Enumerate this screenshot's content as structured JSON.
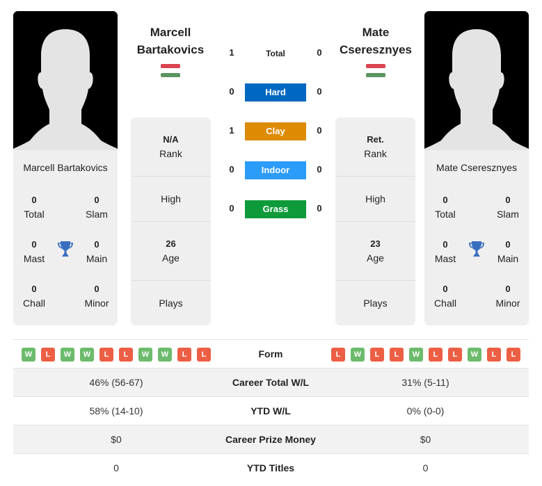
{
  "player1": {
    "name_line1": "Marcell",
    "name_line2": "Bartakovics",
    "full_name": "Marcell Bartakovics",
    "flag": "hungary-flag",
    "titles": {
      "total": {
        "value": "0",
        "label": "Total"
      },
      "slam": {
        "value": "0",
        "label": "Slam"
      },
      "mast": {
        "value": "0",
        "label": "Mast"
      },
      "main": {
        "value": "0",
        "label": "Main"
      },
      "chall": {
        "value": "0",
        "label": "Chall"
      },
      "minor": {
        "value": "0",
        "label": "Minor"
      }
    },
    "info": {
      "rank": {
        "value": "N/A",
        "label": "Rank"
      },
      "high": {
        "value": "",
        "label": "High"
      },
      "age": {
        "value": "26",
        "label": "Age"
      },
      "plays": {
        "value": "",
        "label": "Plays"
      }
    },
    "form": [
      "W",
      "L",
      "W",
      "W",
      "L",
      "L",
      "W",
      "W",
      "L",
      "L"
    ],
    "career_wl": "46% (56-67)",
    "ytd_wl": "58% (14-10)",
    "prize_money": "$0",
    "ytd_titles": "0"
  },
  "player2": {
    "name_line1": "Mate",
    "name_line2": "Cseresznyes",
    "full_name": "Mate Cseresznyes",
    "flag": "hungary-flag",
    "titles": {
      "total": {
        "value": "0",
        "label": "Total"
      },
      "slam": {
        "value": "0",
        "label": "Slam"
      },
      "mast": {
        "value": "0",
        "label": "Mast"
      },
      "main": {
        "value": "0",
        "label": "Main"
      },
      "chall": {
        "value": "0",
        "label": "Chall"
      },
      "minor": {
        "value": "0",
        "label": "Minor"
      }
    },
    "info": {
      "rank": {
        "value": "Ret.",
        "label": "Rank"
      },
      "high": {
        "value": "",
        "label": "High"
      },
      "age": {
        "value": "23",
        "label": "Age"
      },
      "plays": {
        "value": "",
        "label": "Plays"
      }
    },
    "form": [
      "L",
      "W",
      "L",
      "L",
      "W",
      "L",
      "L",
      "W",
      "L",
      "L"
    ],
    "career_wl": "31% (5-11)",
    "ytd_wl": "0% (0-0)",
    "prize_money": "$0",
    "ytd_titles": "0"
  },
  "h2h": [
    {
      "label": "Total",
      "p1": "1",
      "p2": "0",
      "color": ""
    },
    {
      "label": "Hard",
      "p1": "0",
      "p2": "0",
      "color": "#0068c1"
    },
    {
      "label": "Clay",
      "p1": "1",
      "p2": "0",
      "color": "#de8b04"
    },
    {
      "label": "Indoor",
      "p1": "0",
      "p2": "0",
      "color": "#2b9cf9"
    },
    {
      "label": "Grass",
      "p1": "0",
      "p2": "0",
      "color": "#0e9a3a"
    }
  ],
  "table": {
    "form_label": "Form",
    "career_wl_label": "Career Total W/L",
    "ytd_wl_label": "YTD W/L",
    "prize_label": "Career Prize Money",
    "ytd_titles_label": "YTD Titles"
  }
}
